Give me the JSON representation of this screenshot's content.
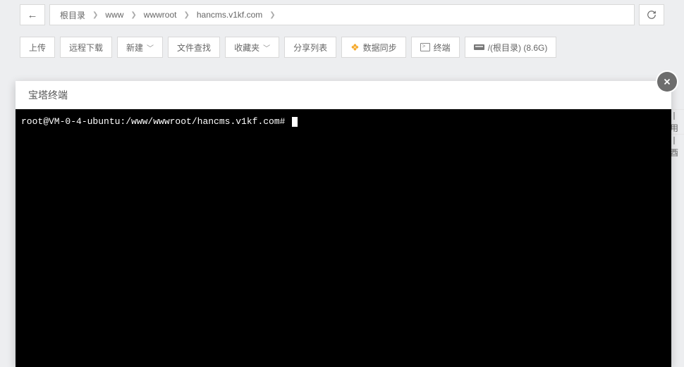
{
  "breadcrumb": {
    "root": "根目录",
    "parts": [
      "www",
      "wwwroot",
      "hancms.v1kf.com"
    ]
  },
  "toolbar": {
    "upload": "上传",
    "remote_download": "远程下载",
    "new": "新建",
    "search": "文件查找",
    "favorites": "收藏夹",
    "share_list": "分享列表",
    "data_sync": "数据同步",
    "terminal": "终端",
    "disk_info": "/(根目录) (8.6G)"
  },
  "modal": {
    "title": "宝塔终端",
    "prompt": "root@VM-0-4-ubuntu:/www/wwwroot/hancms.v1kf.com#"
  },
  "side_peek": {
    "row1": "丨用",
    "row2": "丨酉"
  }
}
